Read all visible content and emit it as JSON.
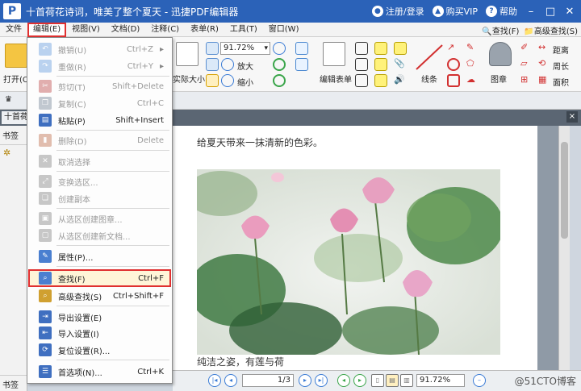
{
  "app": {
    "logo_letter": "P",
    "title": "十首荷花诗词，唯美了整个夏天 - 迅捷PDF编辑器"
  },
  "title_actions": {
    "login_label": "注册/登录",
    "vip_label": "购买VIP",
    "help_label": "帮助"
  },
  "menubar": {
    "items": [
      {
        "label": "文件"
      },
      {
        "label": "编辑(E)"
      },
      {
        "label": "视图(V)"
      },
      {
        "label": "文档(D)"
      },
      {
        "label": "注释(C)"
      },
      {
        "label": "表单(R)"
      },
      {
        "label": "工具(T)"
      },
      {
        "label": "窗口(W)"
      }
    ],
    "find_label": "查找(F)",
    "advanced_find_label": "高级查找(S)"
  },
  "toolbar": {
    "open_label": "打开(O)",
    "actual_size_label": "实际大小",
    "zoom_value": "91.72%",
    "zoom_in_label": "放大",
    "zoom_out_label": "缩小",
    "edit_form_label": "编辑表单",
    "line_label": "线条",
    "stamp_label": "图章",
    "distance_label": "距离",
    "perimeter_label": "周长",
    "area_label": "面积"
  },
  "doc_tab": {
    "label": "十首荷花",
    "close": "×"
  },
  "left_panel": {
    "title": "书签",
    "bottom_label": "书签"
  },
  "page": {
    "line1": "给夏天带来一抹清新的色彩。",
    "line2": "纯洁之姿，有莲与荷"
  },
  "status": {
    "page_value": "1/3",
    "zoom_value": "91.72%",
    "watermark": "@51CTO博客"
  },
  "edit_menu": {
    "items": [
      {
        "label": "撤销(U)",
        "shortcut": "Ctrl+Z",
        "arrow": "▸"
      },
      {
        "label": "重做(R)",
        "shortcut": "Ctrl+Y",
        "arrow": "▸"
      },
      {
        "label": "剪切(T)",
        "shortcut": "Shift+Delete"
      },
      {
        "label": "复制(C)",
        "shortcut": "Ctrl+C"
      },
      {
        "label": "粘贴(P)",
        "shortcut": "Shift+Insert"
      },
      {
        "label": "删除(D)",
        "shortcut": "Delete"
      },
      {
        "label": "取消选择"
      },
      {
        "label": "变换选区..."
      },
      {
        "label": "创建副本"
      },
      {
        "label": "从选区创建图章..."
      },
      {
        "label": "从选区创建新文档..."
      },
      {
        "label": "属性(P)..."
      },
      {
        "label": "查找(F)",
        "shortcut": "Ctrl+F"
      },
      {
        "label": "高级查找(S)",
        "shortcut": "Ctrl+Shift+F"
      },
      {
        "label": "导出设置(E)"
      },
      {
        "label": "导入设置(I)"
      },
      {
        "label": "复位设置(R)..."
      },
      {
        "label": "首选项(N)...",
        "shortcut": "Ctrl+K"
      }
    ]
  },
  "colors": {
    "title_blue": "#2b62b8",
    "highlight_red": "#e03030",
    "menu_hover": "#fff5d8"
  }
}
